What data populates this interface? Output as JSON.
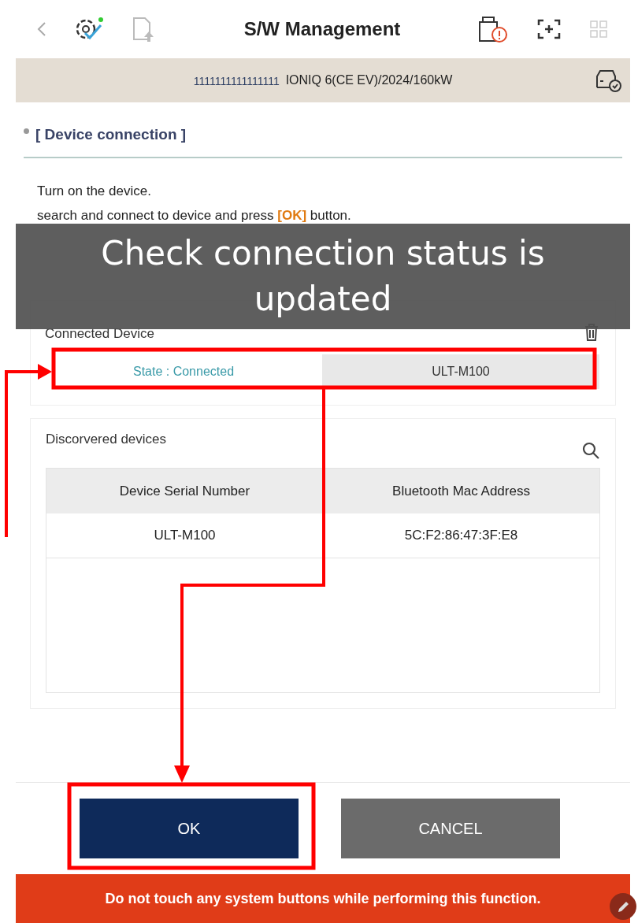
{
  "header": {
    "title": "S/W Management"
  },
  "vehicle_bar": {
    "vin": "1111111111111111",
    "model": "IONIQ 6(CE EV)/2024/160kW"
  },
  "section_title": "[ Device connection ]",
  "instructions": [
    "Turn on the device.",
    "search and connect to device and press **[OK]** button."
  ],
  "connected_device": {
    "title": "Connected Device",
    "state": "State : Connected",
    "device": "ULT-M100"
  },
  "discovered_devices": {
    "title": "Discorvered devices",
    "columns": [
      "Device Serial Number",
      "Bluetooth Mac Address"
    ],
    "rows": [
      [
        "ULT-M100",
        "5C:F2:86:47:3F:E8"
      ]
    ]
  },
  "buttons": [
    {
      "label": "OK",
      "kind": "primary"
    },
    {
      "label": "CANCEL",
      "kind": "secondary"
    }
  ],
  "warning": "Do not touch any system buttons while performing this function.",
  "caption": "Check connection status is updated"
}
